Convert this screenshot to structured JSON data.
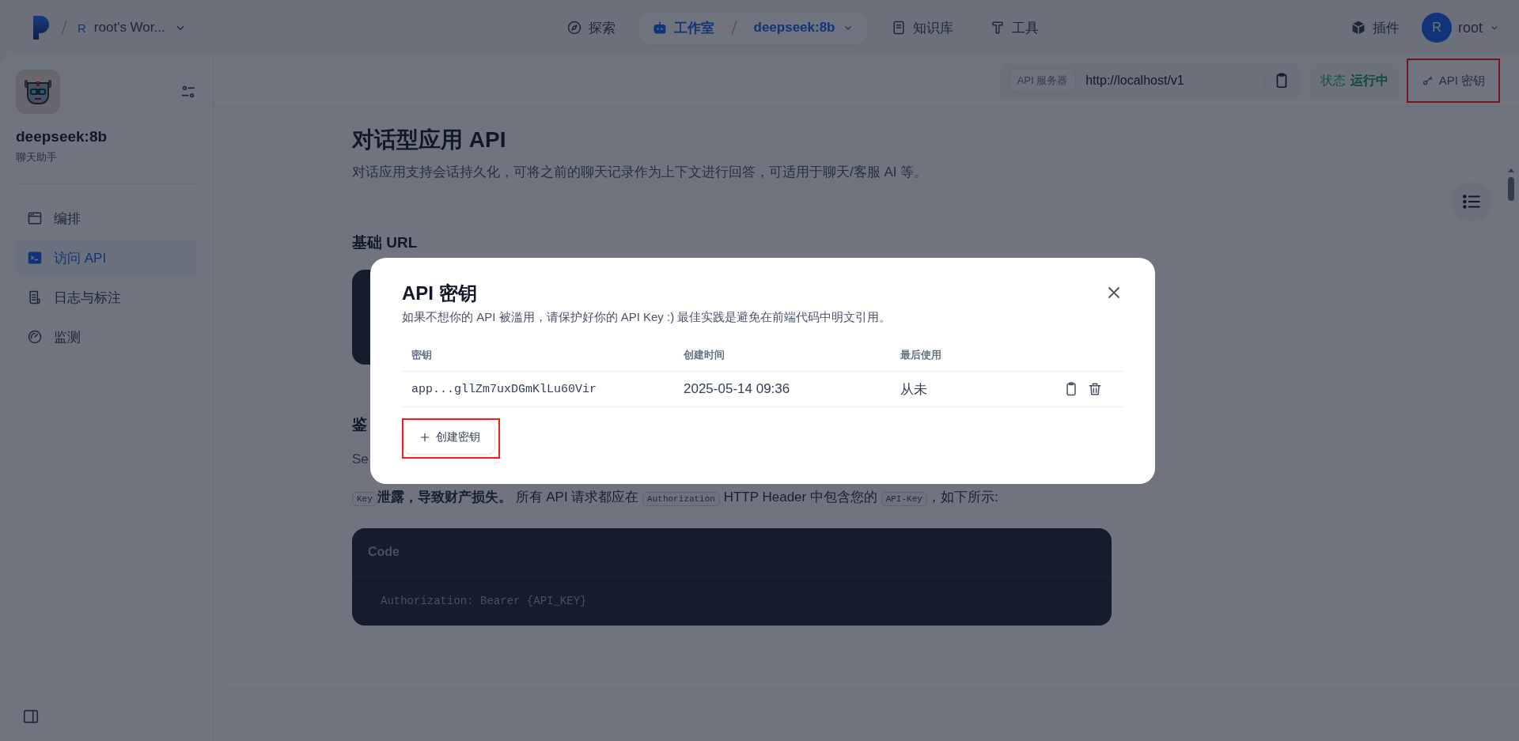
{
  "top_bar": {
    "workspace": {
      "avatar": "R",
      "name": "root's Wor..."
    },
    "nav": [
      {
        "label": "探索",
        "selected": false
      },
      {
        "label": "工作室",
        "app": "deepseek:8b",
        "selected": true
      },
      {
        "label": "知识库",
        "selected": false
      },
      {
        "label": "工具",
        "selected": false
      }
    ],
    "plugins": "插件",
    "user": {
      "avatar": "R",
      "name": "root"
    }
  },
  "sidebar": {
    "app": {
      "name": "deepseek:8b",
      "type": "聊天助手"
    },
    "items": [
      {
        "label": "编排",
        "selected": false
      },
      {
        "label": "访问 API",
        "selected": true
      },
      {
        "label": "日志与标注",
        "selected": false
      },
      {
        "label": "监测",
        "selected": false
      }
    ]
  },
  "api_bar": {
    "server_label": "API 服务器",
    "server_url": "http://localhost/v1",
    "status_label": "状态",
    "status": "运行中",
    "key_button": {
      "label": "API 密钥",
      "highlighted": true
    }
  },
  "doc": {
    "title": "对话型应用 API",
    "description": "对话应用支持会话持久化，可将之前的聊天记录作为上下文进行回答，可适用于聊天/客服 AI 等。",
    "base_url_heading": "基础 URL",
    "auth_heading": "鉴",
    "auth_text": "Se",
    "auth_line": [
      {
        "kind": "code",
        "text": "Key"
      },
      {
        "kind": "text",
        "text": "**泄露，导致财产损失。** 所有 API 请求都应在 "
      },
      {
        "kind": "code",
        "text": "Authorization"
      },
      {
        "kind": "text",
        "text": " HTTP Header 中包含您的 "
      },
      {
        "kind": "code",
        "text": "API-Key"
      },
      {
        "kind": "text",
        "text": "，如下所示:"
      }
    ],
    "code": {
      "title": "Code",
      "body": "Authorization: Bearer {API_KEY}"
    }
  },
  "dialog": {
    "title": "API 密钥",
    "description": "如果不想你的 API 被滥用，请保护好你的 API Key :) 最佳实践是避免在前端代码中明文引用。",
    "columns": [
      "密钥",
      "创建时间",
      "最后使用"
    ],
    "rows": [
      {
        "key": "app...gllZm7uxDGmKlLu60Vir",
        "created": "2025-05-14 09:36",
        "last_used": "从未"
      }
    ],
    "create_button": {
      "label": "创建密钥",
      "highlighted": true
    }
  }
}
